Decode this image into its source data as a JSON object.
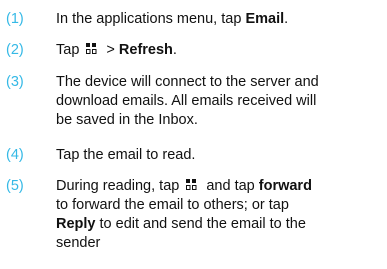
{
  "colors": {
    "step_number": "#35b9e6",
    "text": "#111111"
  },
  "steps": [
    {
      "number": "(1)",
      "parts": [
        "In the applications menu, tap ",
        "Email",
        "."
      ]
    },
    {
      "number": "(2)",
      "parts": [
        "Tap",
        "menu-icon",
        " > ",
        "Refresh",
        "."
      ]
    },
    {
      "number": "(3)",
      "lines": [
        "The device will connect to the server and",
        "download emails. All emails received will",
        "be saved in the Inbox."
      ]
    },
    {
      "number": "(4)",
      "text": "Tap the email to read."
    },
    {
      "number": "(5)",
      "parts": [
        "During reading, tap",
        "menu-icon",
        " and tap ",
        "forward",
        "to forward the email to others; or tap",
        "Reply",
        " to edit and send the email to the",
        "sender"
      ]
    }
  ]
}
